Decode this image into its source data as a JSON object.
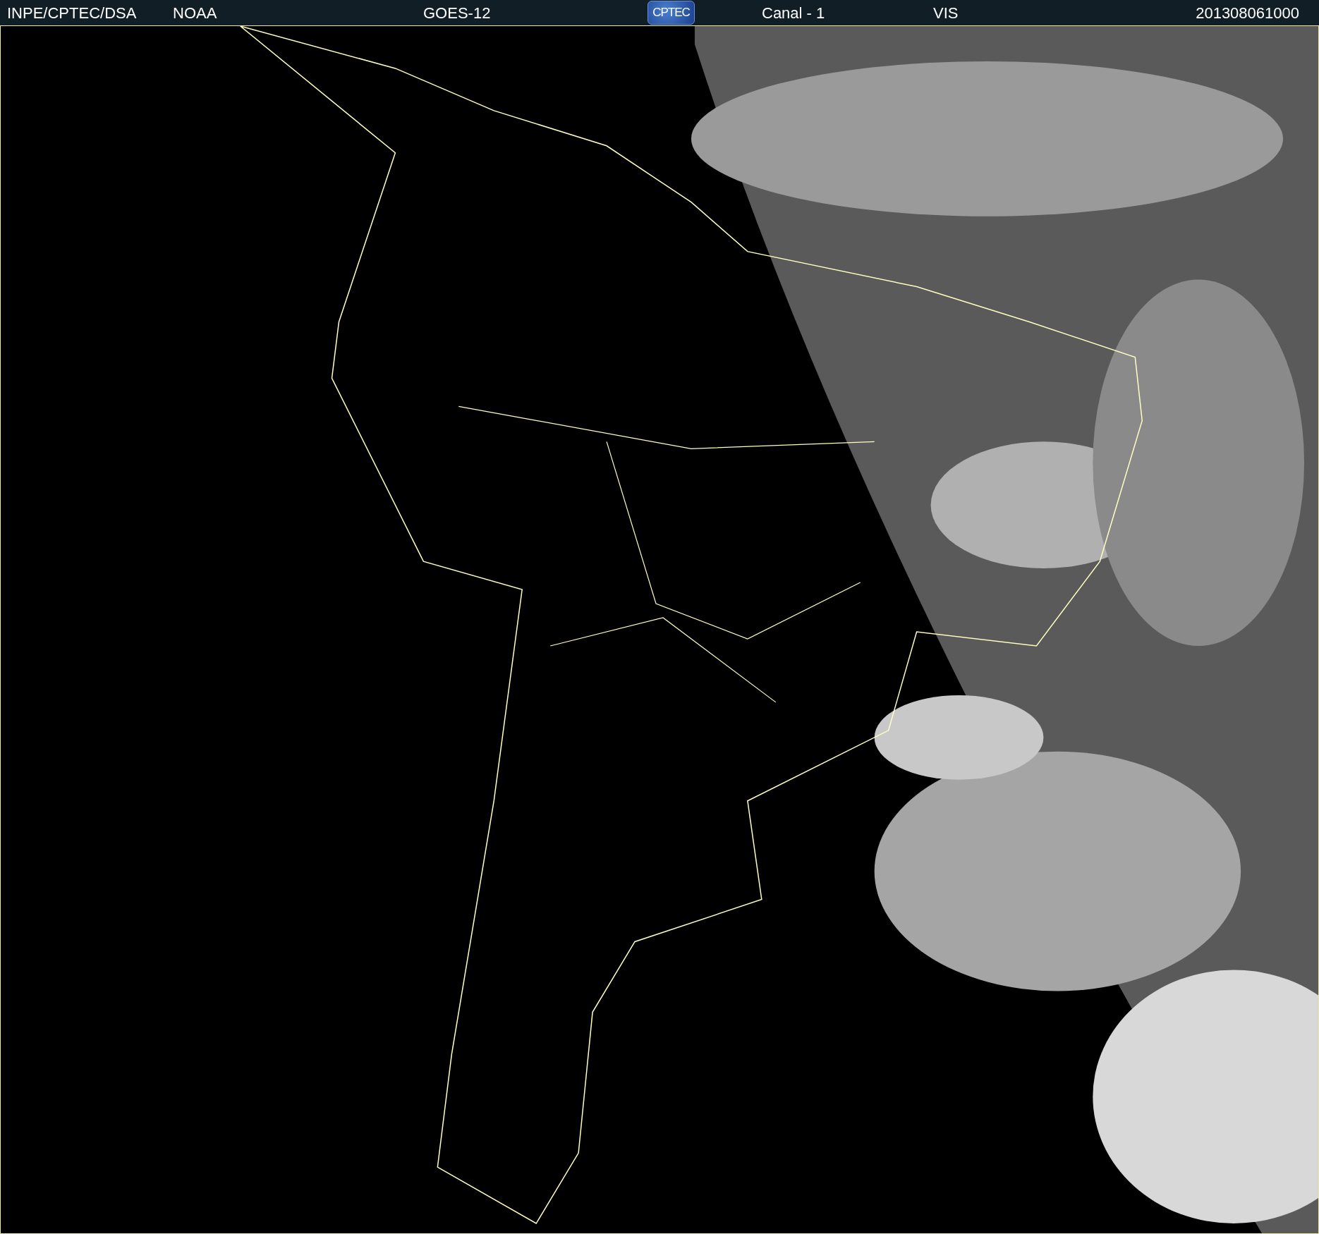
{
  "header": {
    "items": [
      {
        "kind": "text",
        "label": "INPE/CPTEC/DSA"
      },
      {
        "kind": "text",
        "label": "NOAA"
      },
      {
        "kind": "text",
        "label": "GOES-12"
      },
      {
        "kind": "logo",
        "label": "CPTEC"
      },
      {
        "kind": "text",
        "label": "Canal - 1"
      },
      {
        "kind": "text",
        "label": "VIS"
      },
      {
        "kind": "text",
        "label": "201308061000"
      }
    ]
  }
}
